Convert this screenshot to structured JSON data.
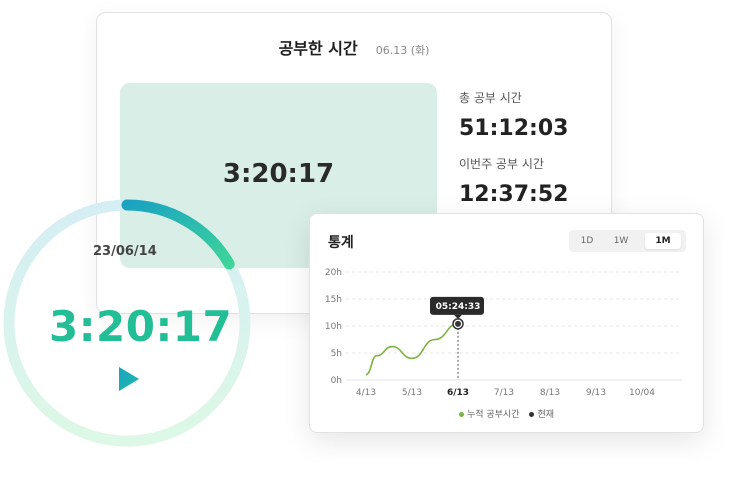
{
  "study_card": {
    "title": "공부한 시간",
    "date": "06.13 (화)",
    "timer_value": "3:20:17",
    "total_label": "총 공부 시간",
    "total_value": "51:12:03",
    "week_label": "이번주 공부 시간",
    "week_value": "12:37:52"
  },
  "ring_timer": {
    "date": "23/06/14",
    "time": "3:20:17",
    "play_icon": "play-icon",
    "colors": {
      "start": "#1aa3c1",
      "end": "#3ed49a",
      "track": "#d6f4ec"
    }
  },
  "stats_card": {
    "title": "통계",
    "ranges": [
      {
        "label": "1D",
        "active": false
      },
      {
        "label": "1W",
        "active": false
      },
      {
        "label": "1M",
        "active": true
      }
    ]
  },
  "chart_data": {
    "type": "line",
    "x_ticks": [
      "4/13",
      "5/13",
      "6/13",
      "7/13",
      "8/13",
      "9/13",
      "10/04"
    ],
    "highlighted_tick": "6/13",
    "y_ticks": [
      "0h",
      "5h",
      "10h",
      "15h",
      "20h"
    ],
    "ylim": [
      0,
      20
    ],
    "grid": true,
    "series": [
      {
        "name": "누적 공부시간",
        "color": "#7cb342",
        "points": [
          {
            "x": "4/13",
            "y": 1.0
          },
          {
            "x": "4/20",
            "y": 4.5
          },
          {
            "x": "4/30",
            "y": 6.2
          },
          {
            "x": "5/13",
            "y": 4.0
          },
          {
            "x": "5/28",
            "y": 7.5
          },
          {
            "x": "6/13",
            "y": 10.4
          }
        ]
      }
    ],
    "current_marker": {
      "name": "현재",
      "x": "6/13",
      "y": 10.4,
      "label": "05:24:33",
      "color": "#333333"
    }
  }
}
